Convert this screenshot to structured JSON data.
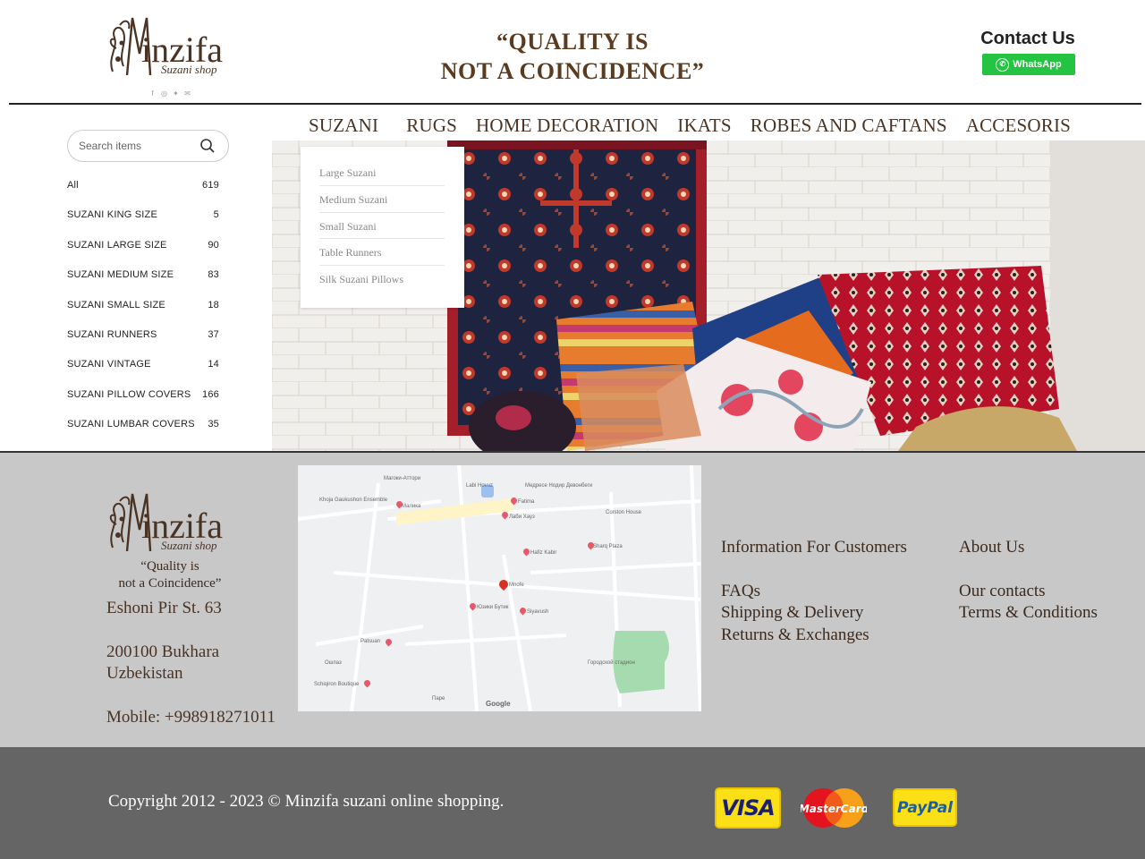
{
  "header": {
    "logo_name": "inzifa",
    "logo_sub": "Suzani shop",
    "socials": [
      {
        "icon": "facebook-icon",
        "glyph": "f"
      },
      {
        "icon": "instagram-icon",
        "glyph": "◎"
      },
      {
        "icon": "twitter-icon",
        "glyph": "✦"
      },
      {
        "icon": "mail-icon",
        "glyph": "✉"
      }
    ],
    "tagline_line1": "“QUALITY IS",
    "tagline_line2": "NOT A COINCIDENCE”",
    "contact_title": "Contact Us",
    "whatsapp_label": "WhatsApp"
  },
  "search": {
    "placeholder": "Search items"
  },
  "categories": [
    {
      "label": "All",
      "count": "619"
    },
    {
      "label": "SUZANI KING SIZE",
      "count": "5"
    },
    {
      "label": "SUZANI LARGE SIZE",
      "count": "90"
    },
    {
      "label": "SUZANI MEDIUM SIZE",
      "count": "83"
    },
    {
      "label": "SUZANI SMALL SIZE",
      "count": "18"
    },
    {
      "label": "SUZANI RUNNERS",
      "count": "37"
    },
    {
      "label": "SUZANI VINTAGE",
      "count": "14"
    },
    {
      "label": "SUZANI PILLOW COVERS",
      "count": "166"
    },
    {
      "label": "SUZANI LUMBAR COVERS",
      "count": "35"
    }
  ],
  "nav": [
    "SUZANI",
    "RUGS",
    "HOME DECORATION",
    "IKATS",
    "ROBES AND CAFTANS",
    "ACCESORIS"
  ],
  "dropdown": [
    "Large Suzani",
    "Medium Suzani",
    "Small Suzani",
    "Table Runners",
    "Silk Suzani Pillows"
  ],
  "footer": {
    "quote_line1": "“Quality is",
    "quote_line2": "not a Coincidence”",
    "street": "Eshoni Pir St. 63",
    "city": "200100 Bukhara",
    "country": "Uzbekistan",
    "mobile": "Mobile: +998918271011",
    "col1_heading": "Information For Customers",
    "col1_links": [
      "FAQs",
      "Shipping & Delivery",
      "Returns & Exchanges"
    ],
    "col2_heading": "About Us",
    "col2_links": [
      "Our contacts",
      "Terms & Conditions"
    ]
  },
  "map_labels": [
    "Магоки-Аттори",
    "Labi Hovuz",
    "Медресе Нодир Девонбеги",
    "Fatima",
    "Khoja Gaukushon Ensemble",
    "Малика",
    "Лаби Хауз",
    "Hafiz Kabir",
    "Sharq Plaza",
    "Mnofe",
    "Юзики Бутик",
    "Siyavush",
    "Patsuan",
    "Ошпаз",
    "Schiqiron Boutique",
    "Городской стадион",
    "Паре",
    "Google",
    "Corston House"
  ],
  "bottom": {
    "copyright": "Copyright 2012 - 2023 © Minzifa suzani online shopping.",
    "visa": "VISA",
    "mastercard": "MasterCard",
    "paypal": "PayPal"
  },
  "colors": {
    "brand_brown": "#4a3322",
    "whatsapp_green": "#25c342",
    "footer_gray": "#c9c8c9",
    "bottom_gray": "#666566"
  }
}
